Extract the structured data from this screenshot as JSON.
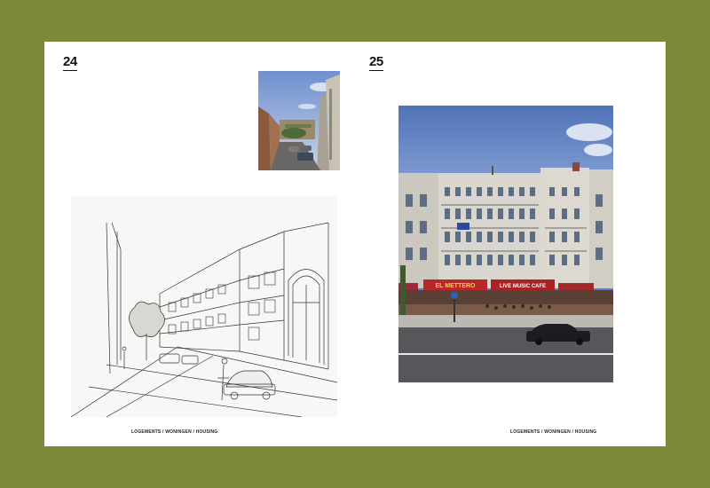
{
  "left_page": {
    "page_number": "24",
    "footer": "LOGEMENTS / WONINGEN / HOUSING"
  },
  "right_page": {
    "page_number": "25",
    "footer": "LOGEMENTS / WONINGEN / HOUSING"
  },
  "photo_signs": {
    "cafe_left": "EL METTERO",
    "cafe_right": "LIVE MUSIC CAFE"
  },
  "colors": {
    "background": "#7a8a38",
    "page": "#ffffff"
  }
}
